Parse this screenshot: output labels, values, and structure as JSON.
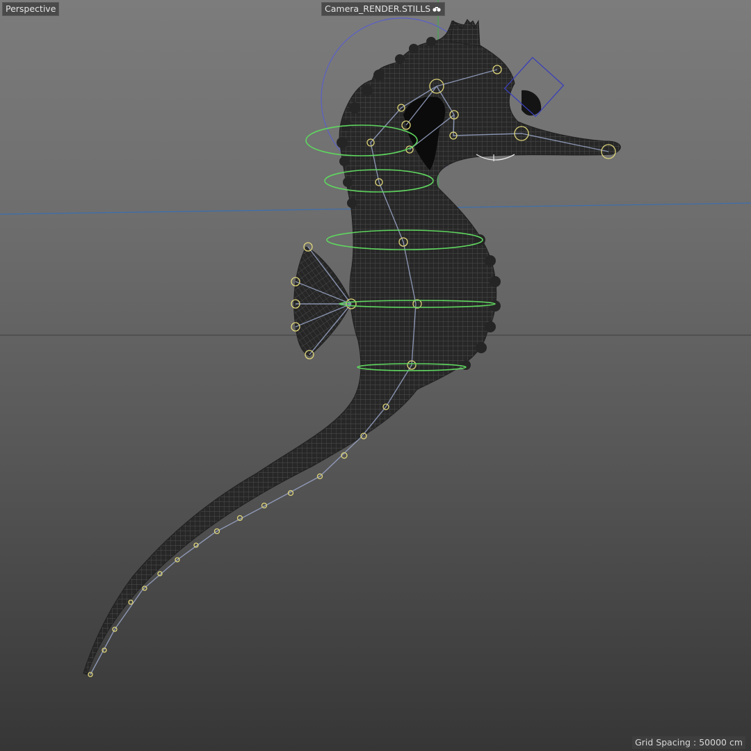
{
  "viewport": {
    "view_name": "Perspective",
    "camera_name": "Camera_RENDER.STILLS",
    "camera_icon": "camera-glasses-icon",
    "grid_spacing": "Grid Spacing : 50000 cm"
  },
  "colors": {
    "background_top": "#7c7c7c",
    "background_bottom": "#363636",
    "mesh_fill": "#262626",
    "wire": "#4e4e4e",
    "bones": "#9aa6c8",
    "joints": "#e0d77a",
    "ring_controllers": "#5fd65f",
    "head_controller": "#5a60c8",
    "axis_x": "#3b6fb0",
    "axis_y": "#41a84f"
  }
}
